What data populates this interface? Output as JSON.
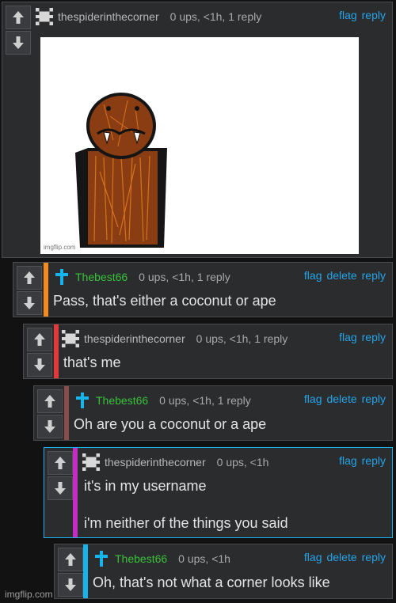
{
  "comments": [
    {
      "user": "thespiderinthecorner",
      "meta": "0 ups, <1h, 1 reply",
      "actions": [
        "flag",
        "reply"
      ],
      "image_watermark": "imgflip.com"
    },
    {
      "user": "Thebest66",
      "meta": "0 ups, <1h, 1 reply",
      "actions": [
        "flag",
        "delete",
        "reply"
      ],
      "text": "Pass, that's either a coconut or ape",
      "accent": "#f28a1c"
    },
    {
      "user": "thespiderinthecorner",
      "meta": "0 ups, <1h, 1 reply",
      "actions": [
        "flag",
        "reply"
      ],
      "text": "that's me",
      "accent": "#e03a3a"
    },
    {
      "user": "Thebest66",
      "meta": "0 ups, <1h, 1 reply",
      "actions": [
        "flag",
        "delete",
        "reply"
      ],
      "text": "Oh are you a coconut or a ape",
      "accent": "#8a4b4b"
    },
    {
      "user": "thespiderinthecorner",
      "meta": "0 ups, <1h",
      "actions": [
        "flag",
        "reply"
      ],
      "text": "it's in my username",
      "text2": "i'm neither of the things you said",
      "accent": "#c22ec2"
    },
    {
      "user": "Thebest66",
      "meta": "0 ups, <1h",
      "actions": [
        "flag",
        "delete",
        "reply"
      ],
      "text": "Oh, that's not what a corner looks like",
      "accent": "#16b3ef"
    }
  ],
  "footer": {
    "logo": "imgflip.com"
  },
  "colors": {
    "link": "#25a4e8",
    "username_green": "#38c23a",
    "background": "#121212",
    "panel": "#2b2c2e"
  }
}
